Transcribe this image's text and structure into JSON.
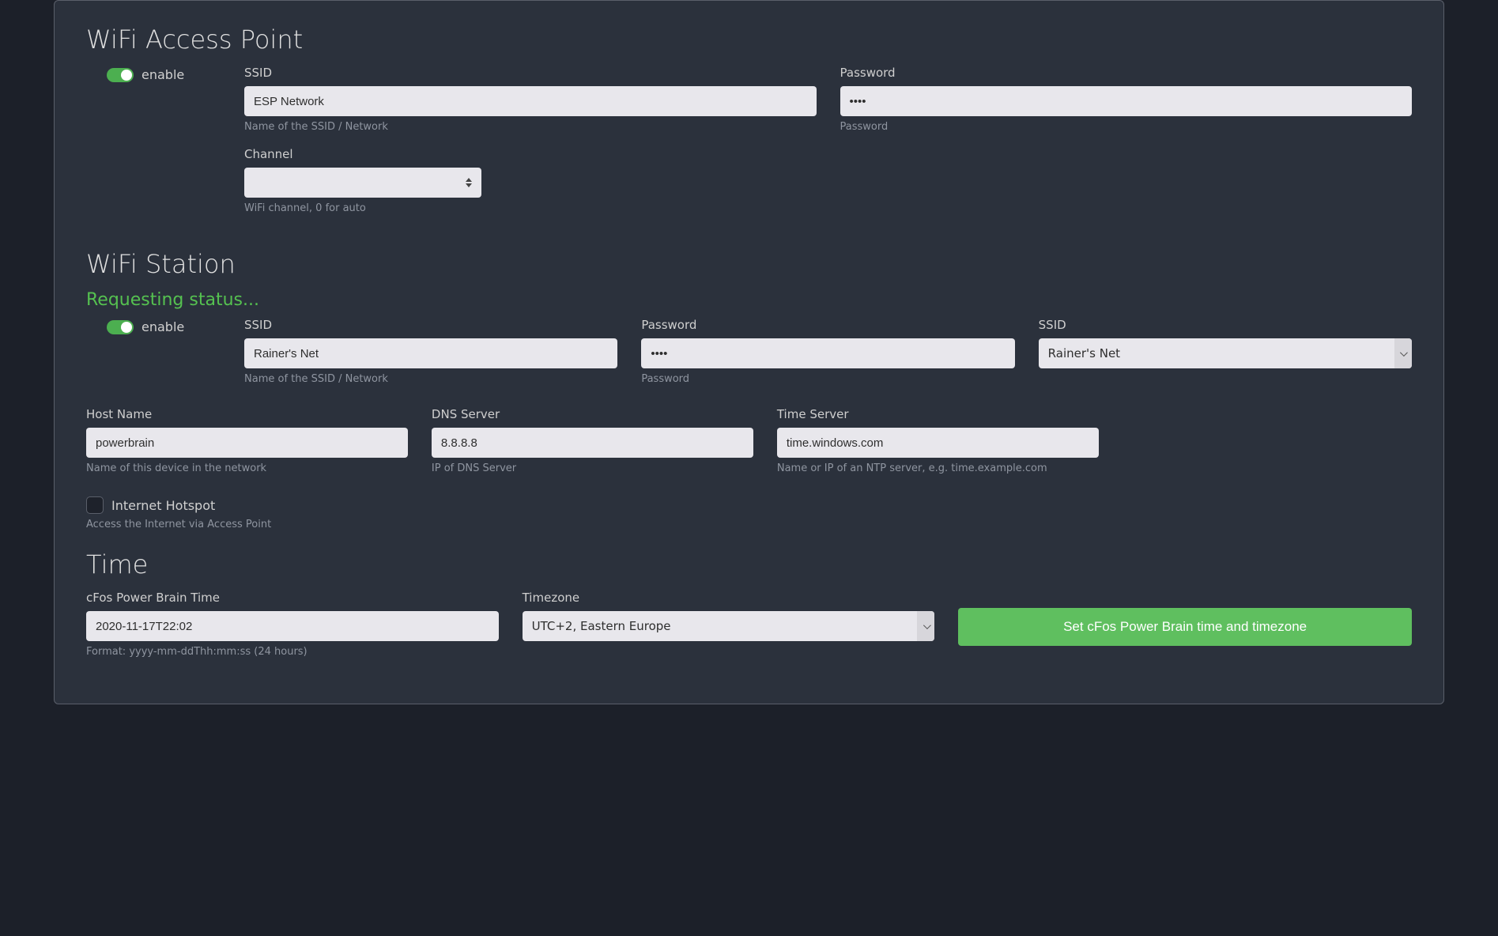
{
  "wifiAP": {
    "heading": "WiFi Access Point",
    "enable_label": "enable",
    "ssid_label": "SSID",
    "ssid_value": "ESP Network",
    "ssid_help": "Name of the SSID / Network",
    "password_label": "Password",
    "password_value": "••••",
    "password_help": "Password",
    "channel_label": "Channel",
    "channel_value": "",
    "channel_help": "WiFi channel, 0 for auto"
  },
  "wifiStation": {
    "heading": "WiFi Station",
    "status": "Requesting status...",
    "enable_label": "enable",
    "ssid_label": "SSID",
    "ssid_value": "Rainer's Net",
    "ssid_help": "Name of the SSID / Network",
    "password_label": "Password",
    "password_value": "••••",
    "password_help": "Password",
    "ssid_select_label": "SSID",
    "ssid_select_value": "Rainer's Net",
    "host_label": "Host Name",
    "host_value": "powerbrain",
    "host_help": "Name of this device in the network",
    "dns_label": "DNS Server",
    "dns_value": "8.8.8.8",
    "dns_help": "IP of DNS Server",
    "time_label": "Time Server",
    "time_value": "time.windows.com",
    "time_help": "Name or IP of an NTP server, e.g. time.example.com",
    "hotspot_label": "Internet Hotspot",
    "hotspot_help": "Access the Internet via Access Point"
  },
  "time": {
    "heading": "Time",
    "time_label": "cFos Power Brain Time",
    "time_value": "2020-11-17T22:02",
    "time_help": "Format: yyyy-mm-ddThh:mm:ss (24 hours)",
    "tz_label": "Timezone",
    "tz_value": "UTC+2, Eastern Europe",
    "button_label": "Set cFos Power Brain time and timezone"
  }
}
